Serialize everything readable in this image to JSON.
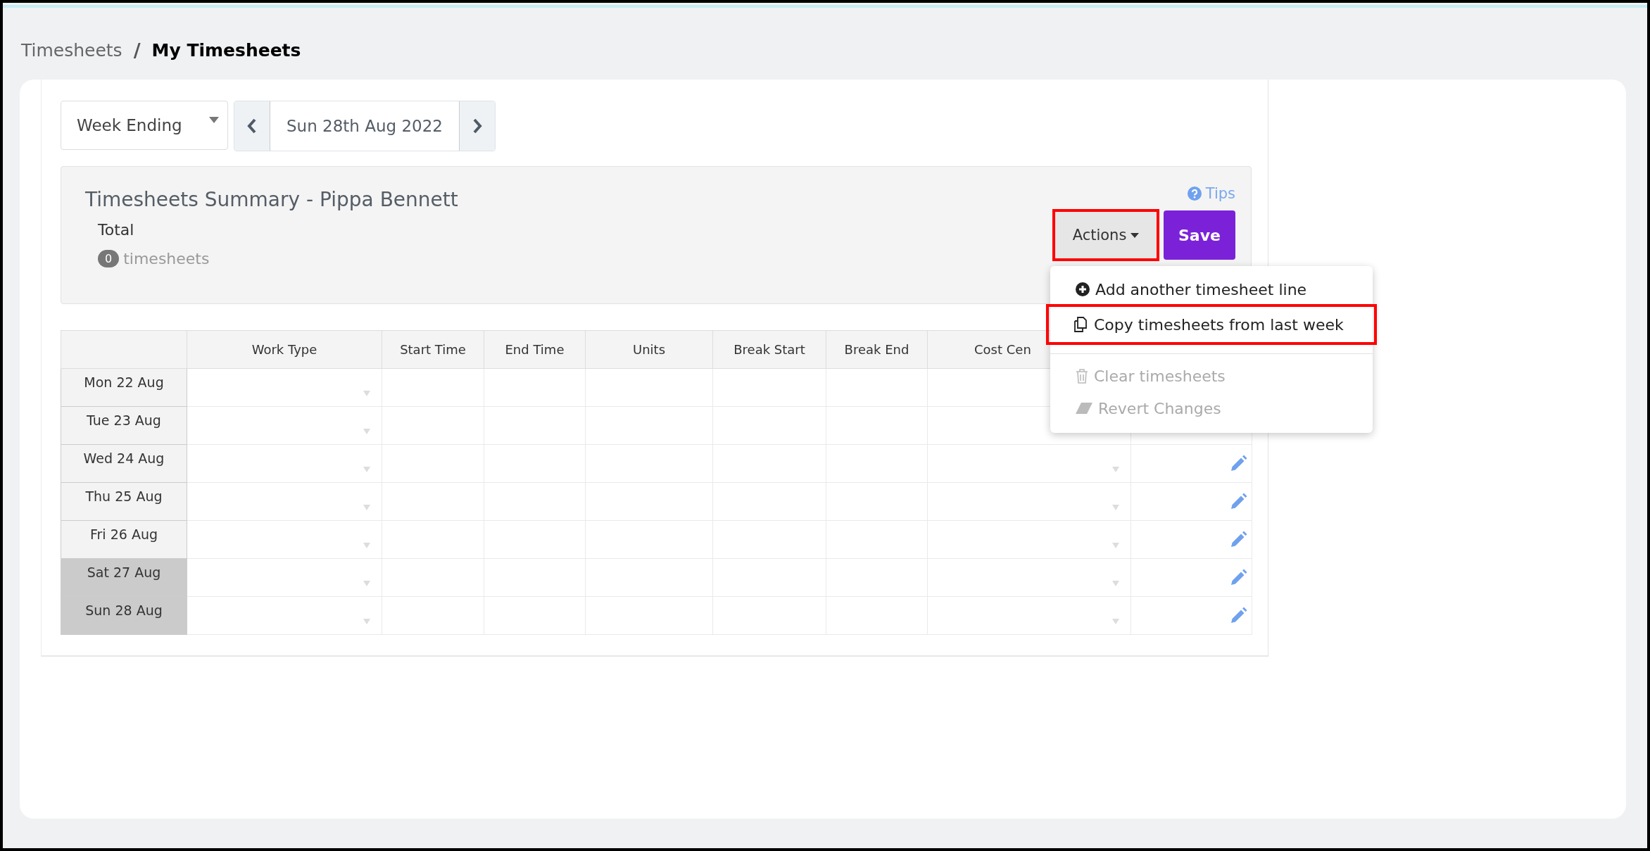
{
  "breadcrumb": {
    "parent": "Timesheets",
    "separator": "/",
    "current": "My Timesheets"
  },
  "period": {
    "mode": "Week Ending",
    "date": "Sun 28th Aug 2022"
  },
  "summary": {
    "title": "Timesheets Summary - Pippa Bennett",
    "tips": "Tips",
    "total_label": "Total",
    "count": "0",
    "count_label": "timesheets"
  },
  "actions": {
    "label": "Actions",
    "highlighted": true
  },
  "save": "Save",
  "menu": [
    {
      "label": "Add another timesheet line",
      "kind": "plus",
      "disabled": false,
      "highlighted": false
    },
    {
      "label": "Copy timesheets from last week",
      "kind": "copy",
      "disabled": false,
      "highlighted": true
    },
    {
      "label": "Clear timesheets",
      "kind": "trash",
      "disabled": true,
      "highlighted": false
    },
    {
      "label": "Revert Changes",
      "kind": "eraser",
      "disabled": true,
      "highlighted": false
    }
  ],
  "table": {
    "columns": [
      "Work Type",
      "Start Time",
      "End Time",
      "Units",
      "Break Start",
      "Break End",
      "Cost Cen"
    ],
    "rows": [
      {
        "day": "Mon 22 Aug",
        "weekend": false
      },
      {
        "day": "Tue 23 Aug",
        "weekend": false
      },
      {
        "day": "Wed 24 Aug",
        "weekend": false
      },
      {
        "day": "Thu 25 Aug",
        "weekend": false
      },
      {
        "day": "Fri 26 Aug",
        "weekend": false
      },
      {
        "day": "Sat 27 Aug",
        "weekend": true
      },
      {
        "day": "Sun 28 Aug",
        "weekend": true
      }
    ]
  }
}
